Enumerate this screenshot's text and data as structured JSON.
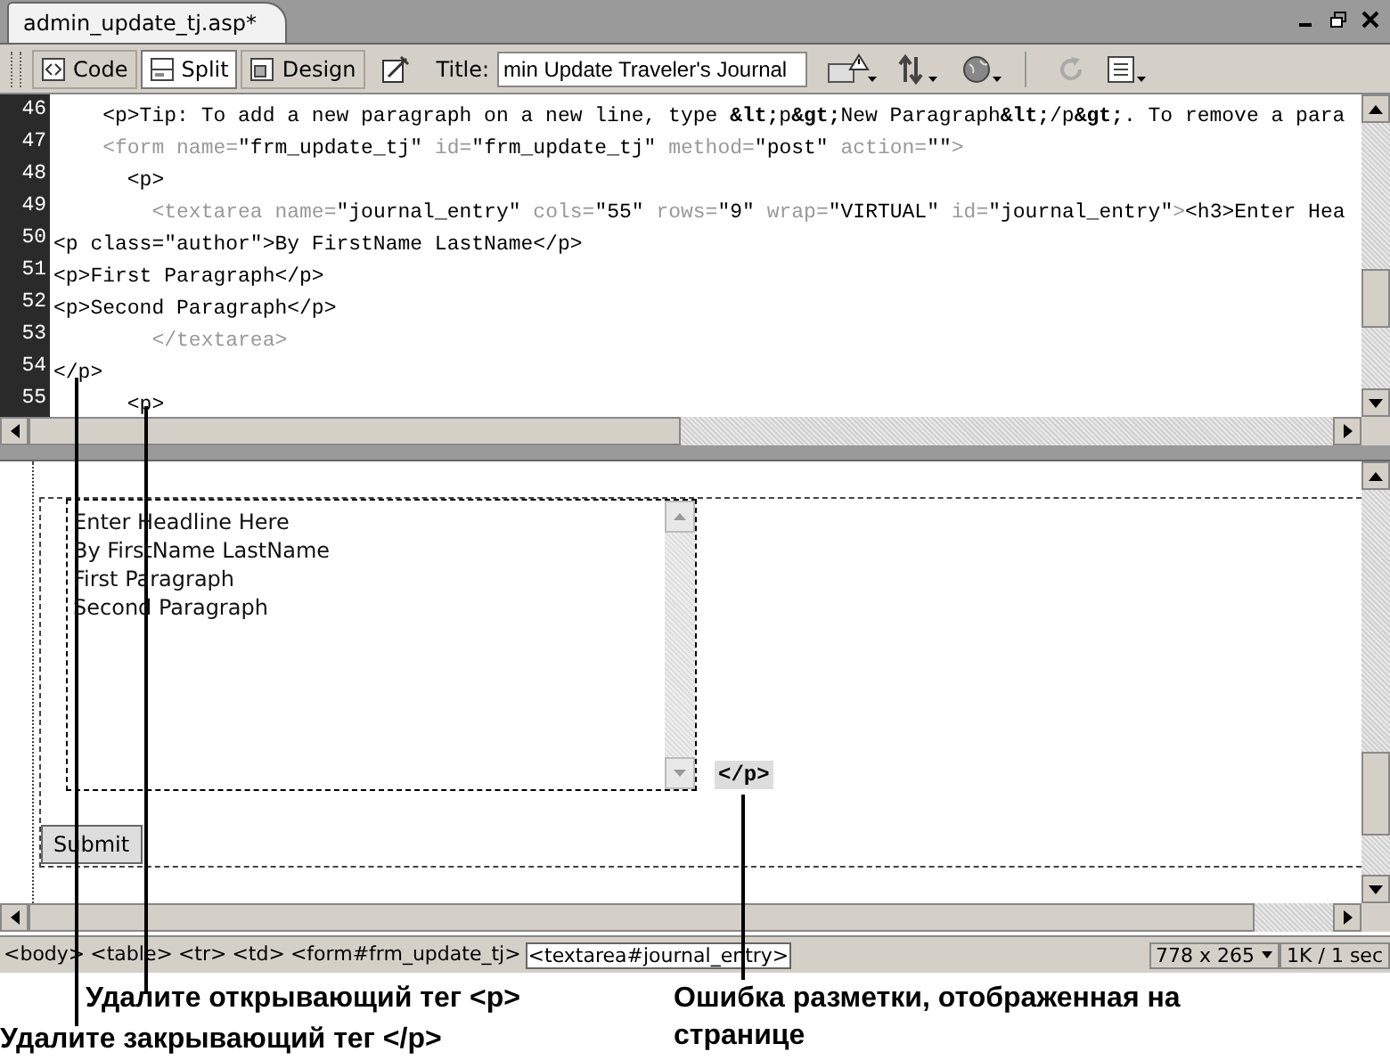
{
  "document_tab": {
    "label": "admin_update_tj.asp*"
  },
  "toolbar": {
    "view_buttons": [
      {
        "label": "Code",
        "selected": false
      },
      {
        "label": "Split",
        "selected": true
      },
      {
        "label": "Design",
        "selected": false
      }
    ],
    "title_label": "Title:",
    "title_value": "min Update Traveler's Journal"
  },
  "code_view": {
    "lines": [
      {
        "number": "46",
        "segments": [
          {
            "text": "    <p>Tip: To add a new paragraph on a new line, type **&lt;**p**&gt;**New Paragraph**&lt;**/p**&gt;**. To remove a para",
            "dim": false
          }
        ]
      },
      {
        "number": "47",
        "segments": [
          {
            "text": "    <form name=",
            "dim": true
          },
          {
            "text": "\"frm_update_tj\"",
            "dim": false
          },
          {
            "text": " id=",
            "dim": true
          },
          {
            "text": "\"frm_update_tj\"",
            "dim": false
          },
          {
            "text": " method=",
            "dim": true
          },
          {
            "text": "\"post\"",
            "dim": false
          },
          {
            "text": " action=",
            "dim": true
          },
          {
            "text": "\"\"",
            "dim": false
          },
          {
            "text": ">",
            "dim": true
          }
        ]
      },
      {
        "number": "48",
        "segments": [
          {
            "text": "      <p>",
            "dim": false
          }
        ]
      },
      {
        "number": "49",
        "segments": [
          {
            "text": "        <textarea name=",
            "dim": true
          },
          {
            "text": "\"journal_entry\"",
            "dim": false
          },
          {
            "text": " cols=",
            "dim": true
          },
          {
            "text": "\"55\"",
            "dim": false
          },
          {
            "text": " rows=",
            "dim": true
          },
          {
            "text": "\"9\"",
            "dim": false
          },
          {
            "text": " wrap=",
            "dim": true
          },
          {
            "text": "\"VIRTUAL\"",
            "dim": false
          },
          {
            "text": " id=",
            "dim": true
          },
          {
            "text": "\"journal_entry\"",
            "dim": false
          },
          {
            "text": ">",
            "dim": true
          },
          {
            "text": "<h3>Enter Hea",
            "dim": false
          }
        ]
      },
      {
        "number": "50",
        "segments": [
          {
            "text": "<p class=\"author\">By FirstName LastName</p>",
            "dim": false
          }
        ]
      },
      {
        "number": "51",
        "segments": [
          {
            "text": "<p>First Paragraph</p>",
            "dim": false
          }
        ]
      },
      {
        "number": "52",
        "segments": [
          {
            "text": "<p>Second Paragraph</p>",
            "dim": false
          }
        ]
      },
      {
        "number": "53",
        "segments": [
          {
            "text": "        </textarea>",
            "dim": true
          }
        ]
      },
      {
        "number": "54",
        "segments": [
          {
            "text": "</p>",
            "dim": false
          }
        ]
      },
      {
        "number": "55",
        "segments": [
          {
            "text": "      <p>",
            "dim": false
          }
        ]
      }
    ]
  },
  "design_view": {
    "textarea_lines": [
      "Enter Headline Here",
      "By FirstName LastName",
      "First Paragraph",
      "Second Paragraph"
    ],
    "error_marker": "</p>",
    "submit_button": "Submit"
  },
  "status_bar": {
    "tags": [
      {
        "label": "<body>",
        "selected": false
      },
      {
        "label": "<table>",
        "selected": false
      },
      {
        "label": "<tr>",
        "selected": false
      },
      {
        "label": "<td>",
        "selected": false
      },
      {
        "label": "<form#frm_update_tj>",
        "selected": false
      },
      {
        "label": "<textarea#journal_entry>",
        "selected": true
      }
    ],
    "window_size": "778 x 265",
    "download": "1K / 1 sec"
  },
  "annotations": [
    {
      "text": "Удалите открывающий тег <p>"
    },
    {
      "text": "Удалите закрывающий тег </p>"
    },
    {
      "text": "Ошибка разметки, отображенная на странице"
    }
  ]
}
